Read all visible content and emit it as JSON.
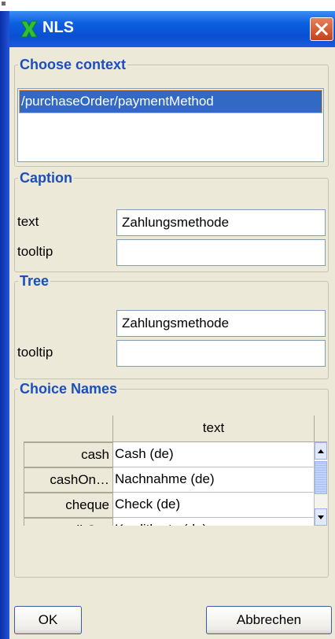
{
  "window": {
    "title": "NLS"
  },
  "context": {
    "legend": "Choose context",
    "items": [
      "/purchaseOrder/paymentMethod"
    ]
  },
  "caption": {
    "legend": "Caption",
    "text_label": "text",
    "text_value": "Zahlungsmethode",
    "tooltip_label": "tooltip",
    "tooltip_value": ""
  },
  "tree": {
    "legend": "Tree",
    "text_value": "Zahlungsmethode",
    "tooltip_label": "tooltip",
    "tooltip_value": ""
  },
  "choice_names": {
    "legend": "Choice Names",
    "column_header": "text",
    "rows": [
      {
        "name": "cash",
        "text": "Cash (de)"
      },
      {
        "name": "cashOn…",
        "text": "Nachnahme (de)"
      },
      {
        "name": "cheque",
        "text": "Check (de)"
      },
      {
        "name": "creditC…",
        "text": "Kreditkarte (de)"
      }
    ]
  },
  "buttons": {
    "ok": "OK",
    "cancel": "Abbrechen"
  },
  "colors": {
    "legend": "#1a4fbf",
    "selection": "#316ac5",
    "titlebar": "#0a4fd2"
  }
}
